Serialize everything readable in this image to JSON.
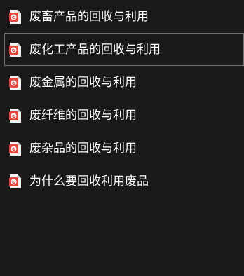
{
  "files": [
    {
      "name": "废畜产品的回收与利用",
      "icon": "pdf-icon",
      "selected": false
    },
    {
      "name": "废化工产品的回收与利用",
      "icon": "pdf-icon",
      "selected": true
    },
    {
      "name": "废金属的回收与利用",
      "icon": "pdf-icon",
      "selected": false
    },
    {
      "name": "废纤维的回收与利用",
      "icon": "pdf-icon",
      "selected": false
    },
    {
      "name": "废杂品的回收与利用",
      "icon": "pdf-icon",
      "selected": false
    },
    {
      "name": "为什么要回收利用废品",
      "icon": "pdf-icon",
      "selected": false
    }
  ],
  "colors": {
    "background": "#191919",
    "text": "#ffffff",
    "selection_border": "#6f6f6f",
    "pdf_red": "#e3473a"
  }
}
